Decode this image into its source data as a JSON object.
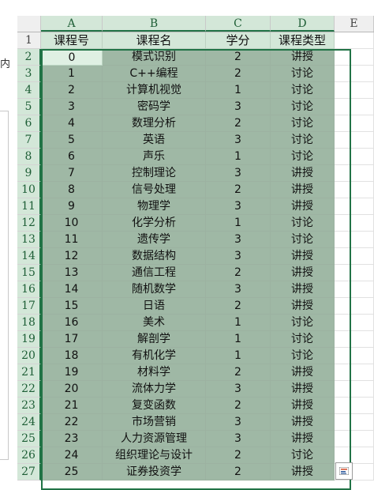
{
  "left_fragment": {
    "text": "内"
  },
  "columns": [
    "A",
    "B",
    "C",
    "D",
    "E"
  ],
  "headers": [
    "课程号",
    "课程名",
    "学分",
    "课程类型"
  ],
  "rows": [
    {
      "num": "1"
    },
    {
      "num": "2",
      "a": "0",
      "b": "模式识别",
      "c": "2",
      "d": "讲授"
    },
    {
      "num": "3",
      "a": "1",
      "b": "C++编程",
      "c": "2",
      "d": "讨论"
    },
    {
      "num": "4",
      "a": "2",
      "b": "计算机视觉",
      "c": "1",
      "d": "讨论"
    },
    {
      "num": "5",
      "a": "3",
      "b": "密码学",
      "c": "3",
      "d": "讨论"
    },
    {
      "num": "6",
      "a": "4",
      "b": "数理分析",
      "c": "2",
      "d": "讨论"
    },
    {
      "num": "7",
      "a": "5",
      "b": "英语",
      "c": "3",
      "d": "讨论"
    },
    {
      "num": "8",
      "a": "6",
      "b": "声乐",
      "c": "1",
      "d": "讨论"
    },
    {
      "num": "9",
      "a": "7",
      "b": "控制理论",
      "c": "3",
      "d": "讲授"
    },
    {
      "num": "10",
      "a": "8",
      "b": "信号处理",
      "c": "2",
      "d": "讲授"
    },
    {
      "num": "11",
      "a": "9",
      "b": "物理学",
      "c": "3",
      "d": "讲授"
    },
    {
      "num": "12",
      "a": "10",
      "b": "化学分析",
      "c": "1",
      "d": "讨论"
    },
    {
      "num": "13",
      "a": "11",
      "b": "遗传学",
      "c": "3",
      "d": "讨论"
    },
    {
      "num": "14",
      "a": "12",
      "b": "数据结构",
      "c": "3",
      "d": "讲授"
    },
    {
      "num": "15",
      "a": "13",
      "b": "通信工程",
      "c": "2",
      "d": "讲授"
    },
    {
      "num": "16",
      "a": "14",
      "b": "随机数学",
      "c": "3",
      "d": "讲授"
    },
    {
      "num": "17",
      "a": "15",
      "b": "日语",
      "c": "2",
      "d": "讲授"
    },
    {
      "num": "18",
      "a": "16",
      "b": "美术",
      "c": "1",
      "d": "讨论"
    },
    {
      "num": "19",
      "a": "17",
      "b": "解剖学",
      "c": "1",
      "d": "讨论"
    },
    {
      "num": "20",
      "a": "18",
      "b": "有机化学",
      "c": "1",
      "d": "讨论"
    },
    {
      "num": "21",
      "a": "19",
      "b": "材料学",
      "c": "2",
      "d": "讲授"
    },
    {
      "num": "22",
      "a": "20",
      "b": "流体力学",
      "c": "3",
      "d": "讲授"
    },
    {
      "num": "23",
      "a": "21",
      "b": "复变函数",
      "c": "2",
      "d": "讲授"
    },
    {
      "num": "24",
      "a": "22",
      "b": "市场营销",
      "c": "3",
      "d": "讲授"
    },
    {
      "num": "25",
      "a": "23",
      "b": "人力资源管理",
      "c": "3",
      "d": "讲授"
    },
    {
      "num": "26",
      "a": "24",
      "b": "组织理论与设计",
      "c": "2",
      "d": "讨论"
    },
    {
      "num": "27",
      "a": "25",
      "b": "证券投资学",
      "c": "2",
      "d": "讲授"
    }
  ],
  "colors": {
    "selection": "#217346",
    "selected_fill": "#9fb8a5",
    "header_fill": "#d3e7d8"
  },
  "quick_analysis": {
    "icon": "quick-analysis-icon"
  }
}
